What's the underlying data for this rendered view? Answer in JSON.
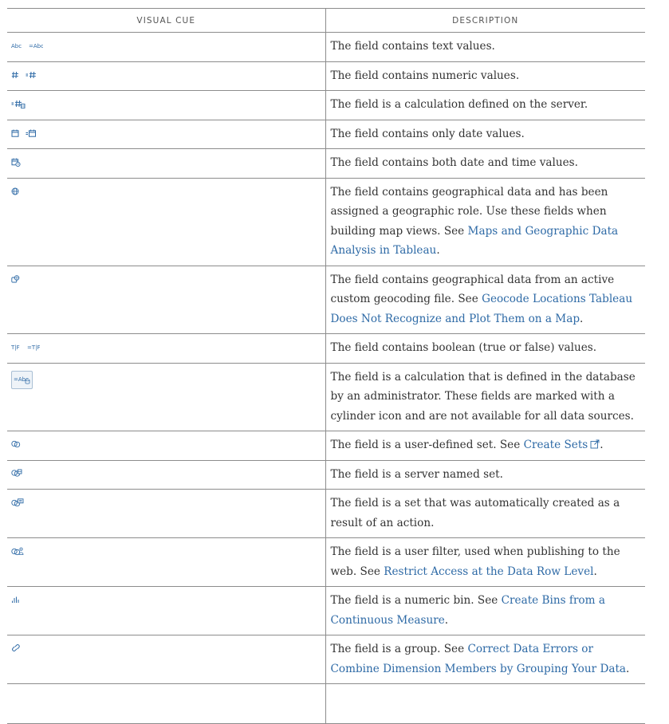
{
  "headers": {
    "visual_cue": "VISUAL CUE",
    "description": "DESCRIPTION"
  },
  "icon_color": "#2e6aa6",
  "link_color": "#2e6aa6",
  "rows": [
    {
      "icons": [
        "text-icon",
        "text-calc-icon"
      ],
      "icon_labels": [
        "Abc",
        "=Abc"
      ],
      "text": "The field contains text values."
    },
    {
      "icons": [
        "number-icon",
        "number-calc-icon"
      ],
      "text": "The field contains numeric values."
    },
    {
      "icons": [
        "server-calc-icon"
      ],
      "text": "The field is a calculation defined on the server."
    },
    {
      "icons": [
        "date-icon",
        "date-calc-icon"
      ],
      "text": "The field contains only date values."
    },
    {
      "icons": [
        "datetime-icon"
      ],
      "text": "The field contains both date and time values."
    },
    {
      "icons": [
        "globe-icon"
      ],
      "text": "The field contains geographical data and has been assigned a geographic role. Use these fields when building map views. See ",
      "link": "Maps and Geographic Data Analysis in Tableau",
      "after": "."
    },
    {
      "icons": [
        "custom-geocode-icon"
      ],
      "text": "The field contains geographical data from an active custom geocoding file. See ",
      "link": "Geocode Locations Tableau Does Not Recognize and Plot Them on a Map",
      "after": "."
    },
    {
      "icons": [
        "boolean-icon",
        "boolean-calc-icon"
      ],
      "icon_labels": [
        "T|F",
        "=T|F"
      ],
      "text": "The field contains boolean (true or false) values."
    },
    {
      "icons": [
        "database-calc-icon"
      ],
      "icon_labels": [
        "=Abc"
      ],
      "text": "The field is a calculation that is defined in the database by an administrator. These fields are marked with a cylinder icon and are not available for all data sources."
    },
    {
      "icons": [
        "set-icon"
      ],
      "text": "The field is a user-defined set. See ",
      "link": "Create Sets",
      "after": ".",
      "external": "external-link-icon"
    },
    {
      "icons": [
        "server-set-icon"
      ],
      "text": "The field is a server named set."
    },
    {
      "icons": [
        "action-set-icon"
      ],
      "text": "The field is a set that was automatically created as a result of an action."
    },
    {
      "icons": [
        "user-filter-icon"
      ],
      "text": "The field is a user filter, used when publishing to the web. See ",
      "link": "Restrict Access at the Data Row Level",
      "after": "."
    },
    {
      "icons": [
        "bin-icon"
      ],
      "text": "The field is a numeric bin. See ",
      "link": "Create Bins from a Continuous Measure",
      "after": "."
    },
    {
      "icons": [
        "group-icon"
      ],
      "text": "The field is a group. See ",
      "link": "Correct Data Errors or Combine Dimension Members by Grouping Your Data",
      "after": "."
    }
  ]
}
